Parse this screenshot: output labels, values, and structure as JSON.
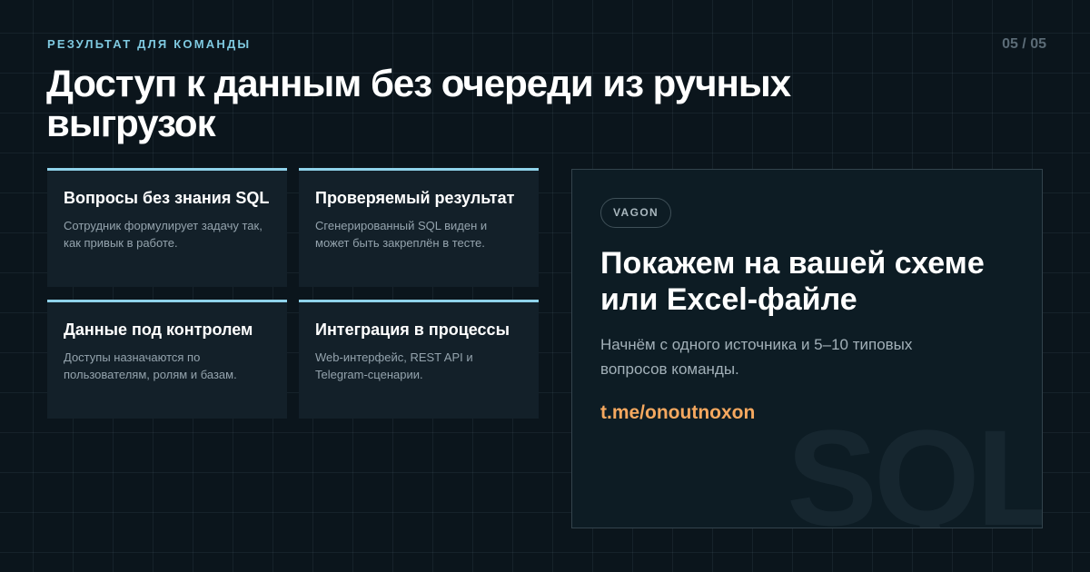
{
  "header": {
    "eyebrow": "РЕЗУЛЬТАТ ДЛЯ КОМАНДЫ",
    "page_counter": "05 / 05",
    "title": "Доступ к данным без очереди из ручных выгрузок"
  },
  "cards": [
    {
      "title": "Вопросы без знания SQL",
      "description": "Сотрудник формулирует задачу так, как привык в работе."
    },
    {
      "title": "Проверяемый результат",
      "description": "Сгенерированный SQL виден и может быть закреплён в тесте."
    },
    {
      "title": "Данные под контролем",
      "description": "Доступы назначаются по пользователям, ролям и базам."
    },
    {
      "title": "Интеграция в процессы",
      "description": "Web-интерфейс, REST API и Telegram-сценарии."
    }
  ],
  "cta": {
    "badge": "VAGON",
    "title": "Покажем на вашей схеме или Excel-файле",
    "description": "Начнём с одного источника и 5–10 типовых вопросов команды.",
    "link": "t.me/onoutnoxon",
    "watermark": "SQL"
  },
  "colors": {
    "background": "#0b151c",
    "accent_cyan": "#8fd2ea",
    "accent_orange": "#f5a85f",
    "card_bg": "#132029"
  }
}
